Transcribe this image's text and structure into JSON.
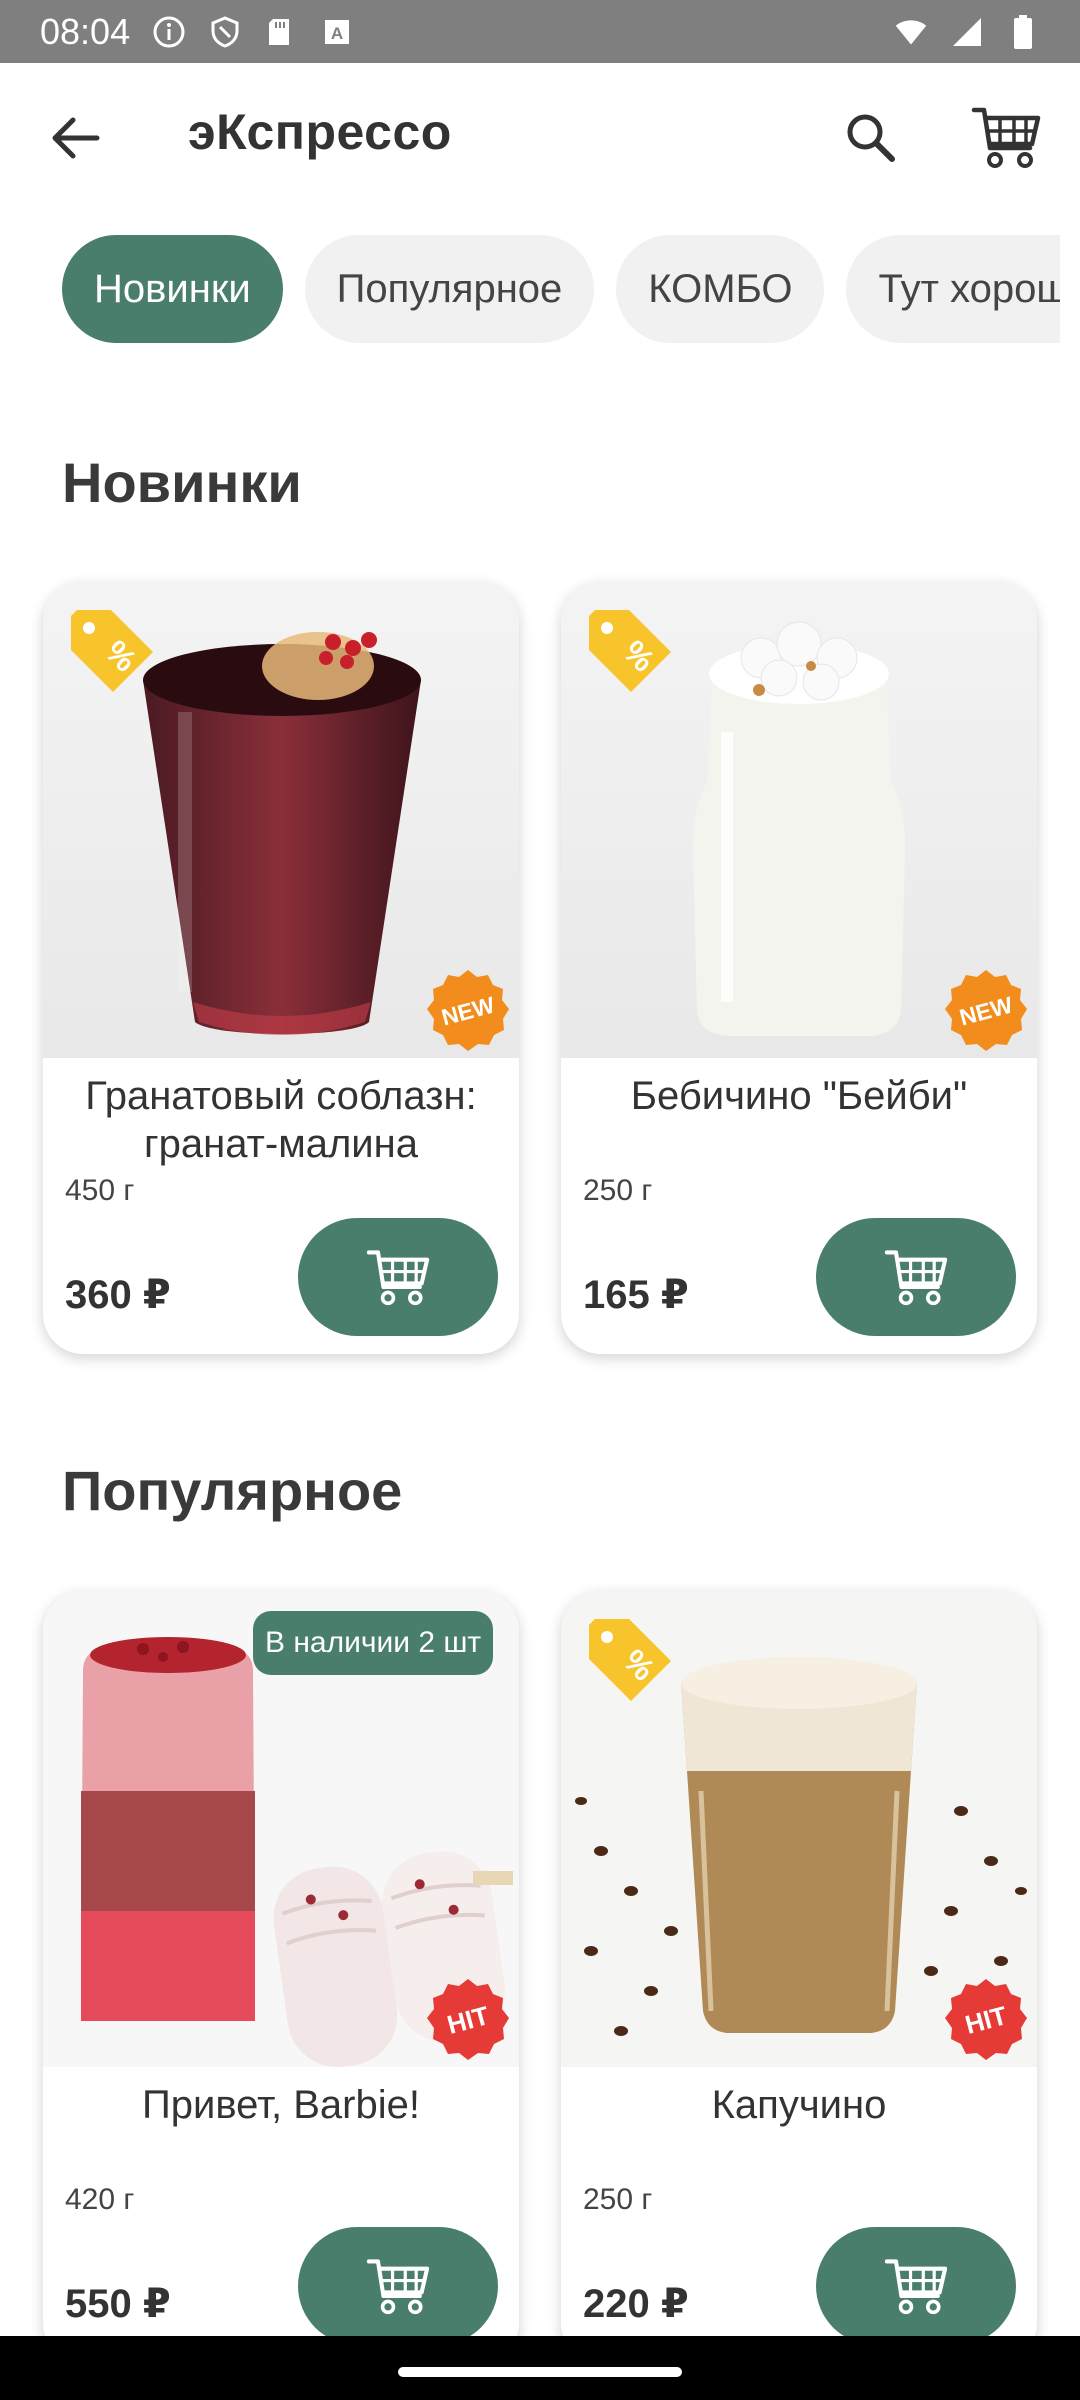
{
  "status_bar": {
    "time": "08:04",
    "icons": [
      "info-icon",
      "shield-icon",
      "sd-card-icon",
      "keyboard-a-icon"
    ],
    "right_icons": [
      "wifi-icon",
      "signal-icon",
      "battery-icon"
    ]
  },
  "app_bar": {
    "title": "эКспрессо",
    "back_icon": "arrow-back-icon",
    "search_icon": "search-icon",
    "cart_icon": "shopping-cart-icon"
  },
  "categories": [
    {
      "label": "Новинки",
      "active": true
    },
    {
      "label": "Популярное",
      "active": false
    },
    {
      "label": "КОМБО",
      "active": false
    },
    {
      "label": "Тут хорошо",
      "active": false
    }
  ],
  "sections": [
    {
      "title": "Новинки",
      "products": [
        {
          "name": "Гранатовый соблазн: гранат-малина",
          "weight": "450 г",
          "price": "360 ₽",
          "badge": "NEW",
          "promo": true,
          "stock": ""
        },
        {
          "name": "Бебичино \"Бейби\"",
          "weight": "250 г",
          "price": "165 ₽",
          "badge": "NEW",
          "promo": true,
          "stock": ""
        }
      ]
    },
    {
      "title": "Популярное",
      "products": [
        {
          "name": "Привет, Barbie!",
          "weight": "420 г",
          "price": "550 ₽",
          "badge": "HIT",
          "promo": false,
          "stock": "В наличии 2 шт"
        },
        {
          "name": "Капучино",
          "weight": "250 г",
          "price": "220 ₽",
          "badge": "HIT",
          "promo": true,
          "stock": ""
        }
      ]
    }
  ],
  "colors": {
    "accent": "#4a7e6c",
    "new_badge": "#f28c1c",
    "hit_badge": "#e63a36",
    "promo_tag": "#f7c52b"
  }
}
